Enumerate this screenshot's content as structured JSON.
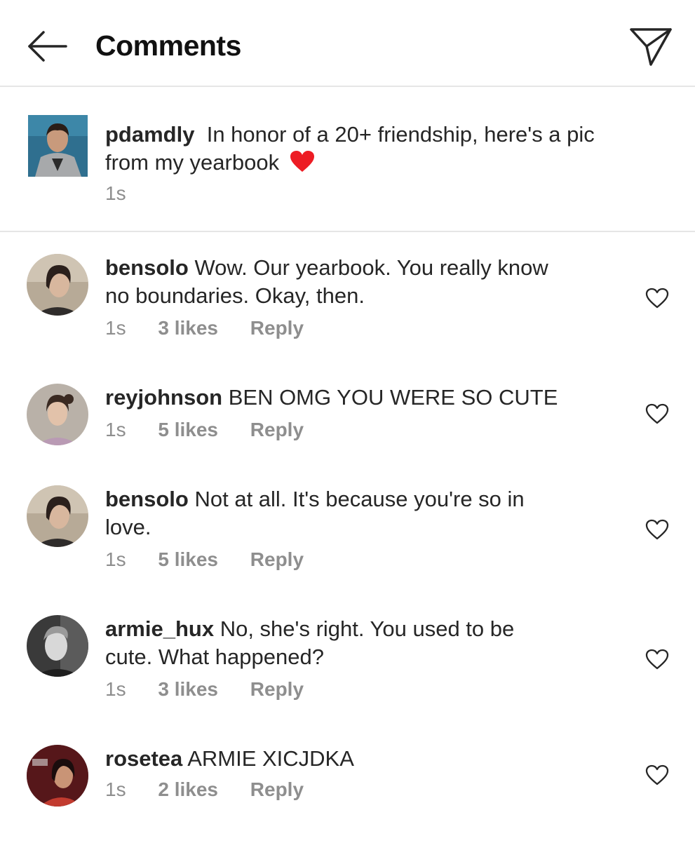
{
  "header": {
    "title": "Comments",
    "back_icon": "arrow-left-icon",
    "send_icon": "paper-plane-icon"
  },
  "post": {
    "username": "pdamdly",
    "caption_line1": "In honor of a 20+ friendship, here's a pic",
    "caption_line2": "from my yearbook",
    "emoji": "red-heart",
    "time": "1s"
  },
  "comments": [
    {
      "username": "bensolo",
      "line1": "Wow. Our yearbook. You really know",
      "line2": "no boundaries. Okay, then.",
      "time": "1s",
      "likes": "3 likes",
      "reply": "Reply"
    },
    {
      "username": "reyjohnson",
      "line1": "BEN OMG YOU WERE SO CUTE",
      "line2": "",
      "time": "1s",
      "likes": "5 likes",
      "reply": "Reply"
    },
    {
      "username": "bensolo",
      "line1": "Not at all. It's because you're so in",
      "line2": "love.",
      "time": "1s",
      "likes": "5 likes",
      "reply": "Reply"
    },
    {
      "username": "armie_hux",
      "line1": "No, she's right. You used to be",
      "line2": "cute. What happened?",
      "time": "1s",
      "likes": "3 likes",
      "reply": "Reply"
    },
    {
      "username": "rosetea",
      "line1": "ARMIE XICJDKA",
      "line2": "",
      "time": "1s",
      "likes": "2 likes",
      "reply": "Reply"
    }
  ],
  "colors": {
    "text": "#262626",
    "secondary": "#8e8e8e",
    "divider": "#e6e6e6",
    "heart_red": "#ed1c24"
  }
}
